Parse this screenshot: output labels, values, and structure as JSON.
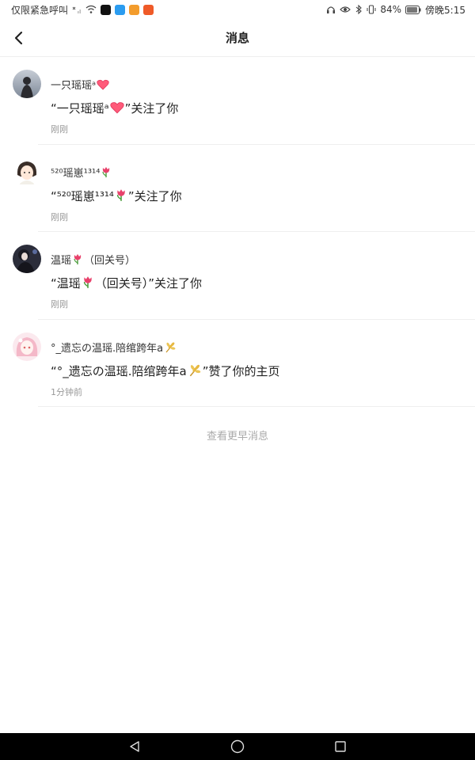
{
  "status_bar": {
    "carrier": "仅限紧急呼叫",
    "battery": "84%",
    "time": "傍晚5:15"
  },
  "header": {
    "title": "消息"
  },
  "messages": [
    {
      "name": "一只瑶瑶ᵃ",
      "name_emoji": "heart",
      "text_prefix": "“一只瑶瑶ᵃ",
      "text_emoji": "heart",
      "text_suffix": "”关注了你",
      "time": "刚刚"
    },
    {
      "name": "⁵²⁰瑶崽¹³¹⁴",
      "name_emoji": "tulip",
      "text_prefix": "“⁵²⁰瑶崽¹³¹⁴",
      "text_emoji": "tulip",
      "text_suffix": "”关注了你",
      "time": "刚刚"
    },
    {
      "name_a": "温瑶",
      "name_b": "（回关号）",
      "name_emoji": "tulip",
      "text_a": "“温瑶",
      "text_b": "（回关号）”关注了你",
      "text_emoji": "tulip",
      "time": "刚刚"
    },
    {
      "name": "°_遗忘の温瑶.陪绾跨年a",
      "name_emoji": "wheat",
      "text_prefix": "“°_遗忘の温瑶.陪绾跨年a",
      "text_emoji": "wheat",
      "text_suffix": "”赞了你的主页",
      "time": "1分钟前"
    }
  ],
  "more": {
    "label": "查看更早消息"
  },
  "colors": {
    "time": "#999999",
    "divider": "#efefef",
    "more_link": "#aaaaaa",
    "nav_bg": "#000000"
  }
}
